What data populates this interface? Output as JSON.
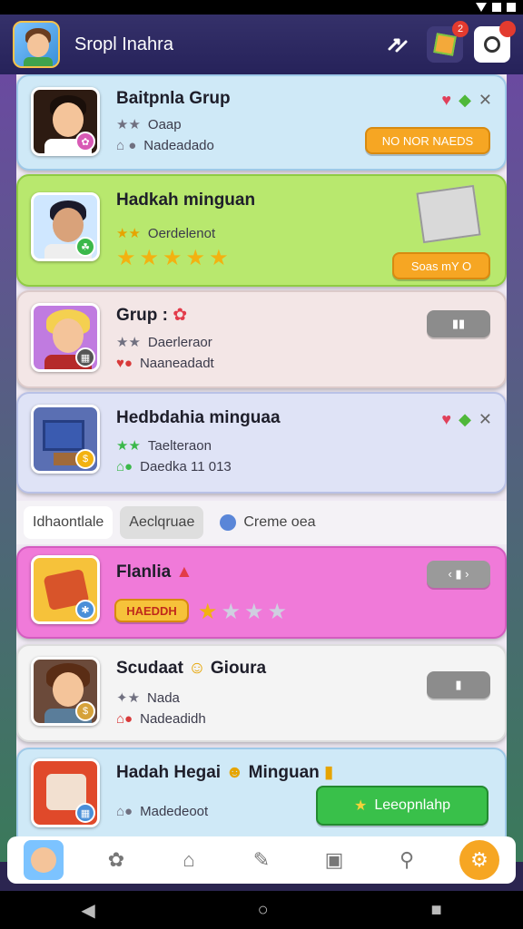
{
  "header": {
    "title": "Sropl Inahra",
    "badge_count": "2"
  },
  "cards": [
    {
      "title": "Baitpnla Grup",
      "line1": "Oaap",
      "line2": "Nadeadado",
      "button": "NO NOR NAEDS"
    },
    {
      "title": "Hadkah minguan",
      "line1": "Oerdelenot",
      "button": "Soas mY O"
    },
    {
      "title": "Grup :",
      "line1": "Daerleraor",
      "line2": "Naaneadadt"
    },
    {
      "title": "Hedbdahia minguaa",
      "line1": "Taelteraon",
      "line2": "Daedka 11 013"
    },
    {
      "title": "Flanlia",
      "tag": "HAEDDH"
    },
    {
      "title": "Scudaat",
      "title_suffix": "Gioura",
      "line1": "Nada",
      "line2": "Nadeadidh"
    },
    {
      "title": "Hadah Hegai",
      "title_suffix": "Minguan",
      "line2": "Madedeoot",
      "button": "Leeopnlahp"
    }
  ],
  "filters": {
    "tab1": "Idhaontlale",
    "tab2": "Aeclqruae",
    "tab3": "Creme oea"
  },
  "icons": {
    "back": "arrow-icon",
    "cube": "cube-icon",
    "camera": "camera-icon",
    "heart": "heart-icon",
    "gem": "gem-icon",
    "close": "close-icon"
  },
  "colors": {
    "card1": "#cfe9f7",
    "card2": "#b8e86e",
    "card3": "#f3e6e6",
    "card4": "#dfe3f6",
    "card5": "#f07ad9",
    "card6": "#f4f4f4",
    "card7": "#cfe9f7",
    "accent": "#f6a623",
    "green_btn": "#39c04a"
  }
}
